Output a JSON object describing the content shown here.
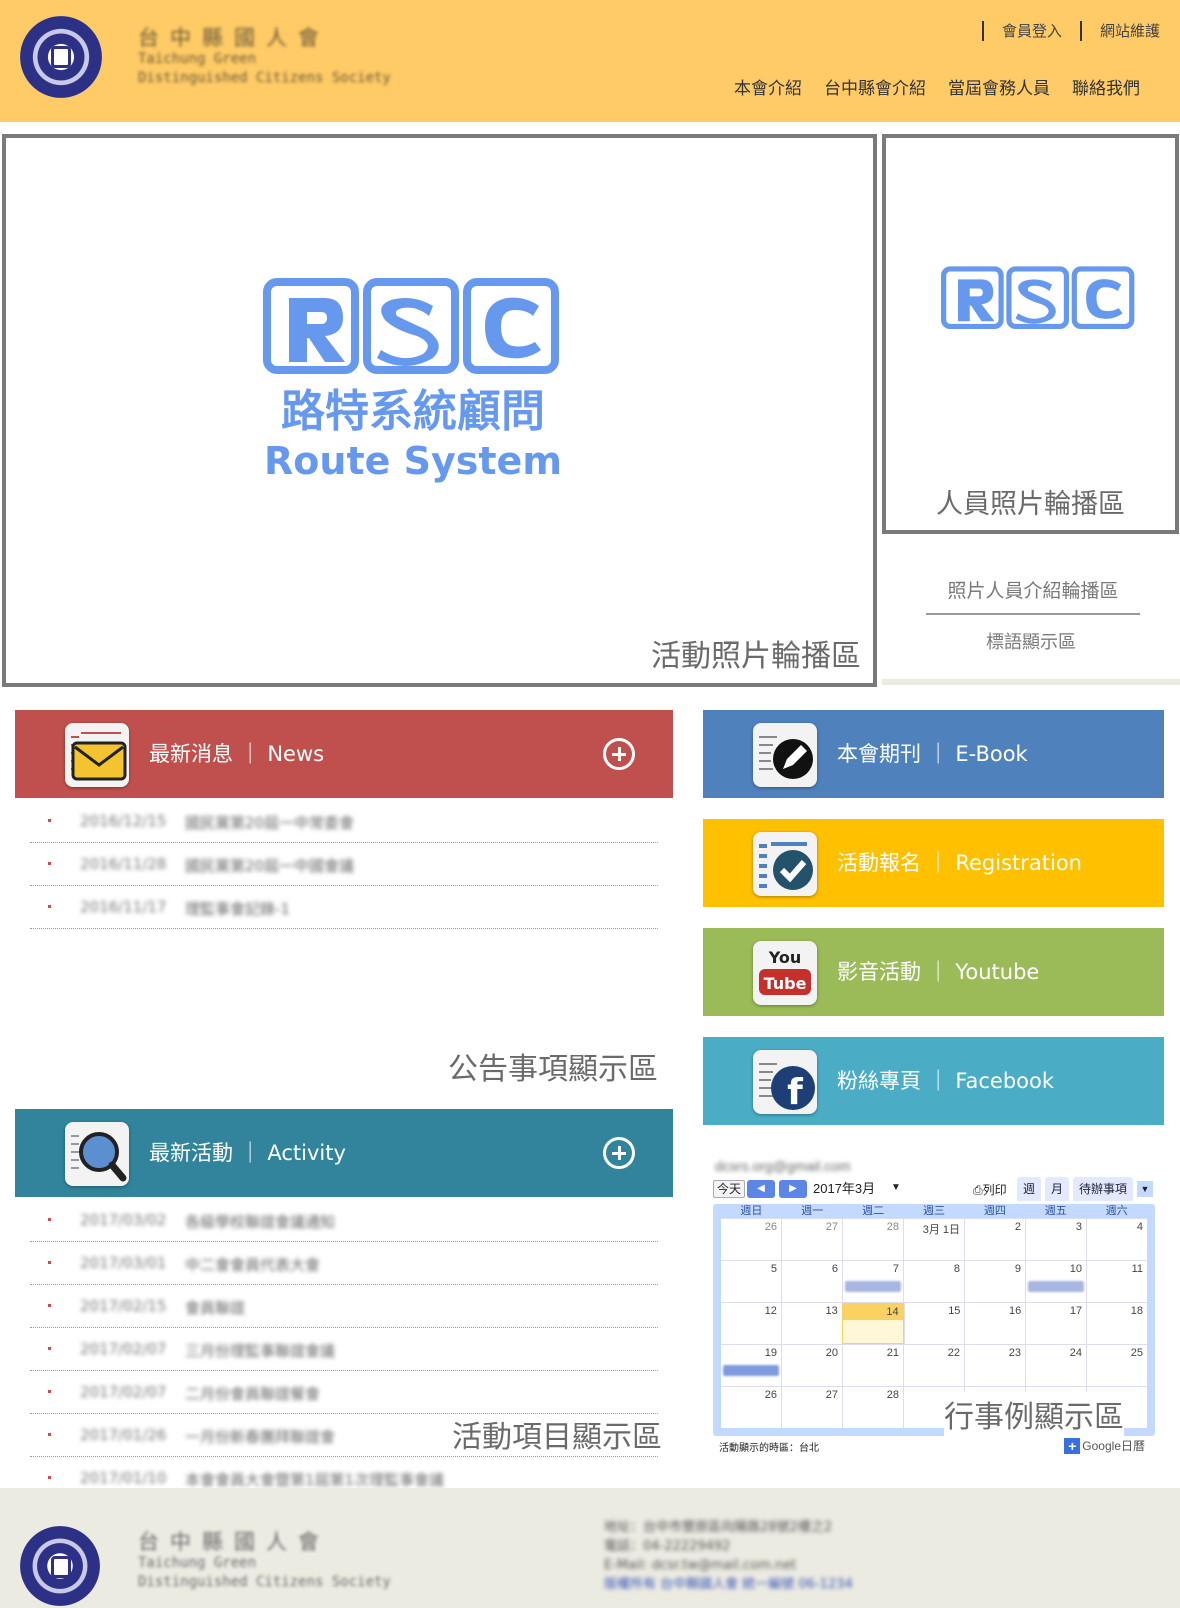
{
  "header": {
    "logo_cn": "台中縣國人會",
    "logo_en_line1": "Taichung Green",
    "logo_en_line2": "Distinguished Citizens Society",
    "top_links": [
      "會員登入",
      "網站維護"
    ],
    "nav": [
      "本會介紹",
      "台中縣會介紹",
      "當屆會務人員",
      "聯絡我們"
    ]
  },
  "slider": {
    "event_caption": "活動照片輪播區",
    "staff_caption": "人員照片輪播區",
    "intro_title": "照片人員介紹輪播區",
    "slogan": "標語顯示區",
    "rsc_cn": "路特系統顧問",
    "rsc_en": "Route System"
  },
  "news": {
    "label": "最新消息 ｜ News",
    "items": [
      {
        "date": "2016/12/15",
        "title": "國民黨第20屆一中常委會"
      },
      {
        "date": "2016/11/28",
        "title": "國民黨第20屆一中國會議"
      },
      {
        "date": "2016/11/17",
        "title": "理監事會記錄-1"
      }
    ],
    "caption": "公告事項顯示區"
  },
  "activity": {
    "label": "最新活動 ｜ Activity",
    "items": [
      {
        "date": "2017/03/02",
        "title": "各級學校聯誼會議通知"
      },
      {
        "date": "2017/03/01",
        "title": "中二會會員代表大會"
      },
      {
        "date": "2017/02/15",
        "title": "會員聯誼"
      },
      {
        "date": "2017/02/07",
        "title": "三月份理監事聯誼會議"
      },
      {
        "date": "2017/02/07",
        "title": "二月份會員聯誼餐會"
      },
      {
        "date": "2017/01/26",
        "title": "一月份新春團拜聯誼會"
      },
      {
        "date": "2017/01/10",
        "title": "本會會員大會暨第1屆第1次理監事會議"
      }
    ],
    "caption": "活動項目顯示區"
  },
  "side_bars": {
    "ebook": "本會期刊 ｜ E-Book",
    "registration": "活動報名 ｜ Registration",
    "youtube": "影音活動 ｜ Youtube",
    "youtube_icon_top": "You",
    "youtube_icon_bottom": "Tube",
    "facebook": "粉絲專頁 ｜ Facebook",
    "facebook_icon_letter": "f"
  },
  "calendar": {
    "email": "dcsrs.org@gmail.com",
    "today_btn": "今天",
    "month": "2017年3月",
    "print": "列印",
    "view_week": "週",
    "view_month": "月",
    "view_agenda": "待辦事項",
    "weekdays": [
      "週日",
      "週一",
      "週二",
      "週三",
      "週四",
      "週五",
      "週六"
    ],
    "weeks": [
      [
        "26",
        "27",
        "28",
        "3月 1日",
        "2",
        "3",
        "4"
      ],
      [
        "5",
        "6",
        "7",
        "8",
        "9",
        "10",
        "11"
      ],
      [
        "12",
        "13",
        "14",
        "15",
        "16",
        "17",
        "18"
      ],
      [
        "19",
        "20",
        "21",
        "22",
        "23",
        "24",
        "25"
      ],
      [
        "26",
        "27",
        "28",
        "",
        "",
        "",
        ""
      ]
    ],
    "timezone": "活動顯示的時區：台北",
    "google": "Google日曆",
    "caption": "行事例顯示區"
  },
  "footer": {
    "address": "地址：台中市豐原區向陽路28號2樓之2",
    "phone": "電話：04-22229492",
    "email": "E-Mail: dcsr.tw@mail.com.net",
    "link": "版權所有 台中縣國人會 統一編號 06-1234"
  }
}
